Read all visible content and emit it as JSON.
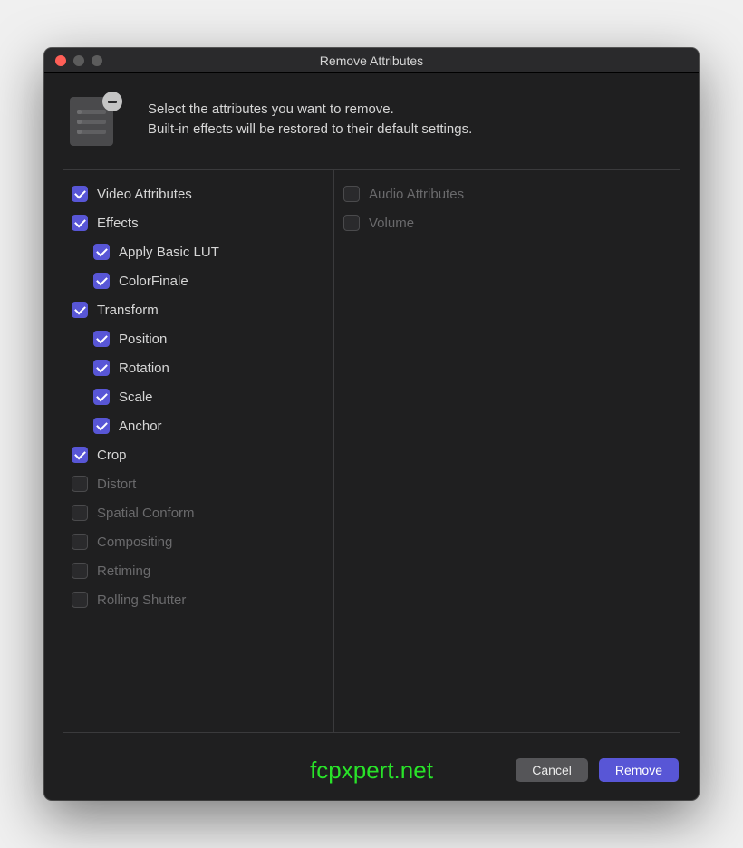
{
  "window": {
    "title": "Remove Attributes"
  },
  "header": {
    "line1": "Select the attributes you want to remove.",
    "line2": "Built-in effects will be restored to their default settings."
  },
  "video": {
    "header": {
      "label": "Video Attributes",
      "checked": true
    },
    "groups": [
      {
        "label": "Effects",
        "checked": true,
        "children": [
          {
            "label": "Apply Basic LUT",
            "checked": true
          },
          {
            "label": "ColorFinale",
            "checked": true
          }
        ]
      },
      {
        "label": "Transform",
        "checked": true,
        "children": [
          {
            "label": "Position",
            "checked": true
          },
          {
            "label": "Rotation",
            "checked": true
          },
          {
            "label": "Scale",
            "checked": true
          },
          {
            "label": "Anchor",
            "checked": true
          }
        ]
      },
      {
        "label": "Crop",
        "checked": true,
        "children": []
      },
      {
        "label": "Distort",
        "checked": false,
        "disabled": true,
        "children": []
      },
      {
        "label": "Spatial Conform",
        "checked": false,
        "disabled": true,
        "children": []
      },
      {
        "label": "Compositing",
        "checked": false,
        "disabled": true,
        "children": []
      },
      {
        "label": "Retiming",
        "checked": false,
        "disabled": true,
        "children": []
      },
      {
        "label": "Rolling Shutter",
        "checked": false,
        "disabled": true,
        "children": []
      }
    ]
  },
  "audio": {
    "header": {
      "label": "Audio Attributes",
      "checked": false,
      "disabled": true
    },
    "groups": [
      {
        "label": "Volume",
        "checked": false,
        "disabled": true,
        "children": []
      }
    ]
  },
  "footer": {
    "cancel": "Cancel",
    "remove": "Remove"
  },
  "watermark": "fcpxpert.net"
}
